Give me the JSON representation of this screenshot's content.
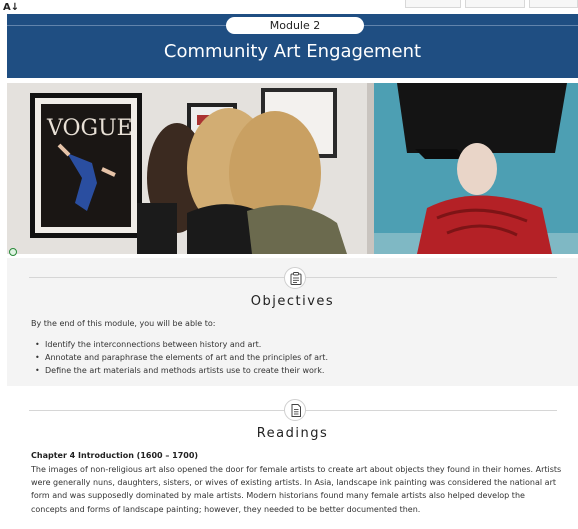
{
  "accessibility_icon_glyph": "A↓",
  "module": {
    "label": "Module  2",
    "title": "Community Art Engagement"
  },
  "hero": {
    "sign_text": "VOGUE"
  },
  "objectives": {
    "heading": "Objectives",
    "intro": "By the end of this module, you will be able to:",
    "items": [
      "Identify the interconnections between history and art.",
      "Annotate and paraphrase the elements of art and the principles of art.",
      "Define the art materials and methods artists use to create their work."
    ]
  },
  "readings": {
    "heading": "Readings",
    "chapter_title": "Chapter 4 Introduction (1600 – 1700)",
    "body": "The images of non-religious art also opened the door for female artists to create art about objects they found in their homes. Artists were generally nuns, daughters, sisters, or wives of existing artists. In Asia, landscape ink painting was considered the national art form and was supposedly dominated by male artists. Modern historians found many female artists also helped develop the concepts and forms of landscape painting; however, they needed to be better documented then."
  },
  "colors": {
    "banner": "#1f4e82",
    "section_gray": "#f4f4f4"
  },
  "icons": [
    "accessibility-icon",
    "clipboard-icon",
    "document-icon",
    "expand-icon"
  ]
}
